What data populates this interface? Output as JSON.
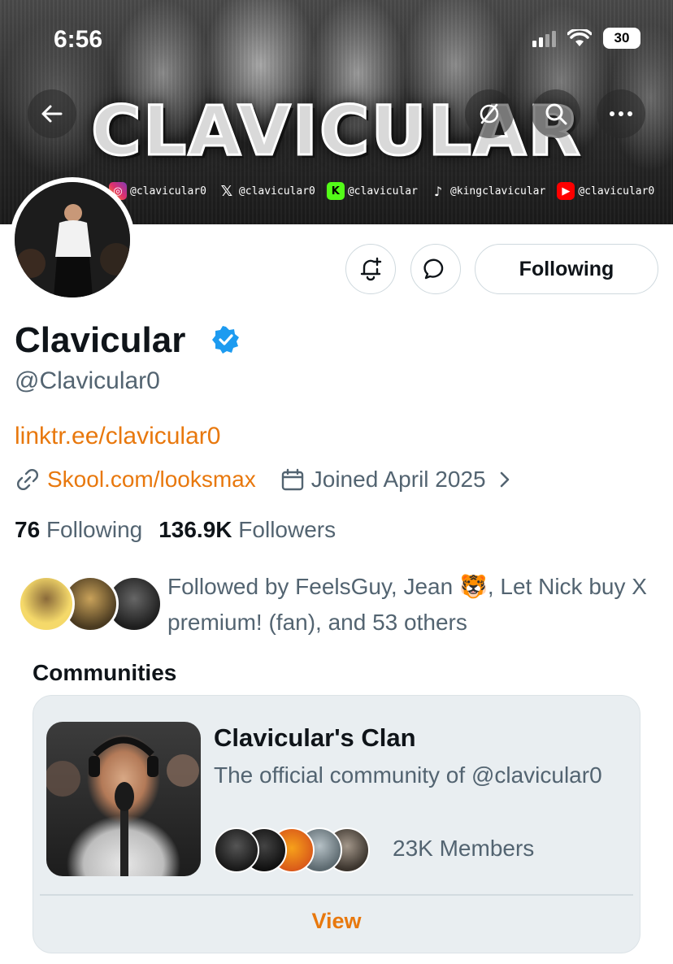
{
  "status_bar": {
    "time": "6:56",
    "battery": "30"
  },
  "banner": {
    "title": "CLAVICULAR",
    "socials": [
      {
        "icon": "instagram-icon",
        "handle": "@clavicular0"
      },
      {
        "icon": "x-icon",
        "handle": "@clavicular0"
      },
      {
        "icon": "kick-icon",
        "handle": "@clavicular"
      },
      {
        "icon": "tiktok-icon",
        "handle": "@kingclavicular"
      },
      {
        "icon": "youtube-icon",
        "handle": "@clavicular0"
      }
    ]
  },
  "profile": {
    "display_name": "Clavicular",
    "handle": "@Clavicular0",
    "bio_link": "linktr.ee/clavicular0",
    "website": "Skool.com/looksmax",
    "joined": "Joined April 2025",
    "following_count": "76",
    "following_label": "Following",
    "followers_count": "136.9K",
    "followers_label": "Followers",
    "followed_by": "Followed by FeelsGuy, Jean 🐯, Let Nick buy X premium! (fan), and 53 others"
  },
  "actions": {
    "following_button": "Following"
  },
  "communities": {
    "section_title": "Communities",
    "name": "Clavicular's Clan",
    "description": "The official community of @clavicular0",
    "members": "23K Members",
    "view_label": "View"
  },
  "colors": {
    "accent": "#e8780d",
    "verified": "#1d9bf0",
    "secondary_text": "#536471"
  }
}
